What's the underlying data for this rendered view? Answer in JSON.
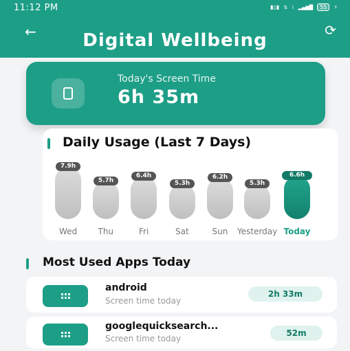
{
  "status_bar": {
    "time": "11:12 PM",
    "battery": "55"
  },
  "header": {
    "title": "Digital Wellbeing",
    "back_icon": "arrow-left-icon",
    "refresh_icon": "refresh-icon"
  },
  "screen_time": {
    "label": "Today's Screen Time",
    "value": "6h 35m",
    "icon": "phone-icon"
  },
  "daily_usage": {
    "title": "Daily Usage (Last 7 Days)"
  },
  "chart_data": {
    "type": "bar",
    "categories": [
      "Wed",
      "Thu",
      "Fri",
      "Sat",
      "Sun",
      "Yesterday",
      "Today"
    ],
    "values": [
      7.9,
      5.7,
      6.4,
      5.3,
      6.2,
      5.3,
      6.6
    ],
    "value_labels": [
      "7.9h",
      "5.7h",
      "6.4h",
      "5.3h",
      "6.2h",
      "5.3h",
      "6.6h"
    ],
    "highlight": "Today",
    "colors": {
      "default": "#cccccc",
      "highlight": "#1d9e87"
    }
  },
  "most_used": {
    "title": "Most Used Apps Today",
    "apps": [
      {
        "name": "android",
        "subtitle": "Screen time today",
        "time": "2h 33m",
        "icon": "app-grid-icon"
      },
      {
        "name": "googlequicksearch...",
        "subtitle": "Screen time today",
        "time": "52m",
        "icon": "app-grid-icon"
      }
    ]
  },
  "colors": {
    "accent": "#1d9e87",
    "background": "#f3f4f6"
  }
}
